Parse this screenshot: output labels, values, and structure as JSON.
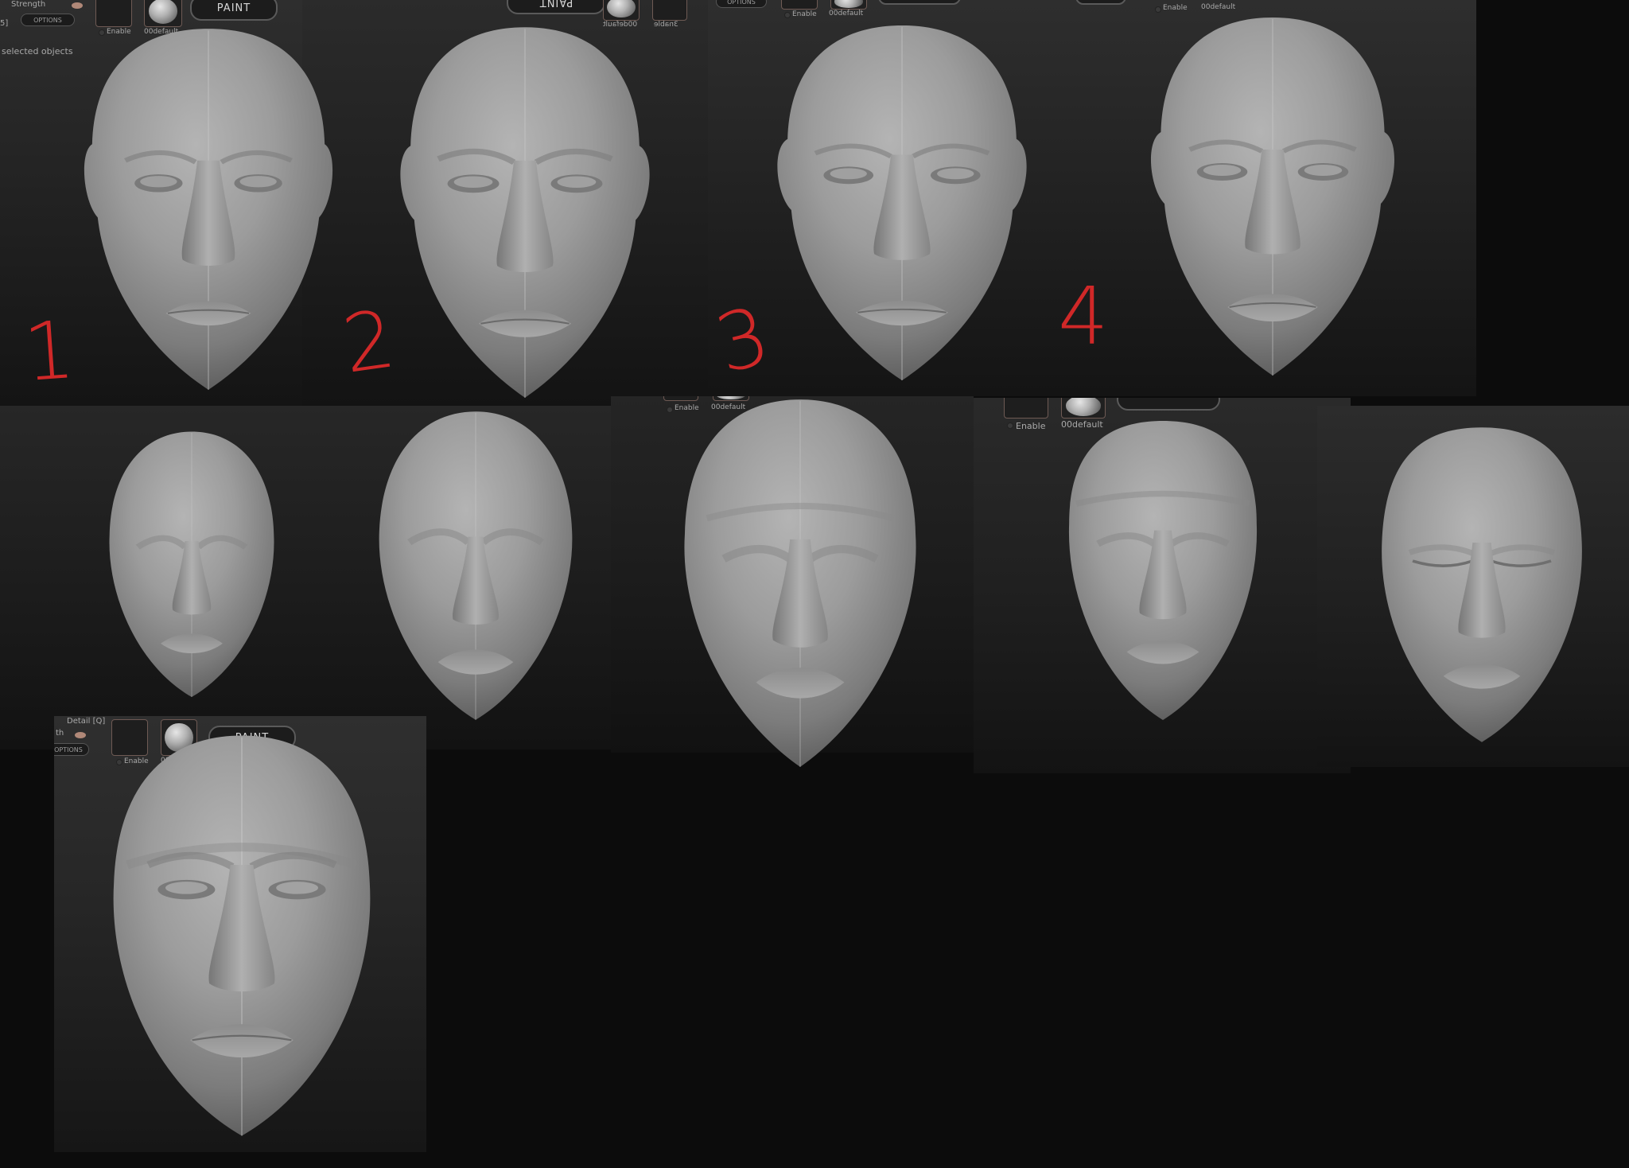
{
  "ui": {
    "strength_label": "Strength",
    "options_label": "OPTIONS",
    "enable_label": "Enable",
    "material_label": "00default",
    "paint_label": "PAINT",
    "mirrored_paint_label": "PAINT",
    "mirrored_material_label": "00default",
    "mirrored_extra_label": "3nable",
    "selected_objects_label": "selected objects",
    "bracket_label": "5]",
    "detail_label": "Detail [Q]",
    "strength_fragment": "th"
  },
  "iterations": [
    {
      "number": "1"
    },
    {
      "number": "2"
    },
    {
      "number": "3"
    },
    {
      "number": "4"
    }
  ],
  "colors": {
    "annotation_red": "#d02828",
    "clay_grey": "#9b9b9b",
    "background": "#0c0c0c"
  }
}
